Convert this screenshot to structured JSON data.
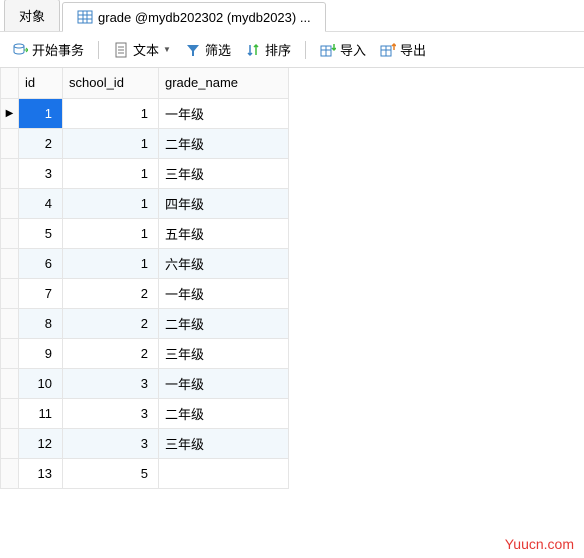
{
  "tabs": {
    "object": "对象",
    "table": "grade @mydb202302 (mydb2023) ..."
  },
  "toolbar": {
    "begin_tx": "开始事务",
    "text": "文本",
    "filter": "筛选",
    "sort": "排序",
    "import": "导入",
    "export": "导出"
  },
  "columns": [
    "id",
    "school_id",
    "grade_name"
  ],
  "rows": [
    {
      "id": 1,
      "school_id": 1,
      "grade_name": "一年级"
    },
    {
      "id": 2,
      "school_id": 1,
      "grade_name": "二年级"
    },
    {
      "id": 3,
      "school_id": 1,
      "grade_name": "三年级"
    },
    {
      "id": 4,
      "school_id": 1,
      "grade_name": "四年级"
    },
    {
      "id": 5,
      "school_id": 1,
      "grade_name": "五年级"
    },
    {
      "id": 6,
      "school_id": 1,
      "grade_name": "六年级"
    },
    {
      "id": 7,
      "school_id": 2,
      "grade_name": "一年级"
    },
    {
      "id": 8,
      "school_id": 2,
      "grade_name": "二年级"
    },
    {
      "id": 9,
      "school_id": 2,
      "grade_name": "三年级"
    },
    {
      "id": 10,
      "school_id": 3,
      "grade_name": "一年级"
    },
    {
      "id": 11,
      "school_id": 3,
      "grade_name": "二年级"
    },
    {
      "id": 12,
      "school_id": 3,
      "grade_name": "三年级"
    },
    {
      "id": 13,
      "school_id": 5,
      "grade_name": ""
    }
  ],
  "selected_row": 0,
  "watermark": "Yuucn.com"
}
